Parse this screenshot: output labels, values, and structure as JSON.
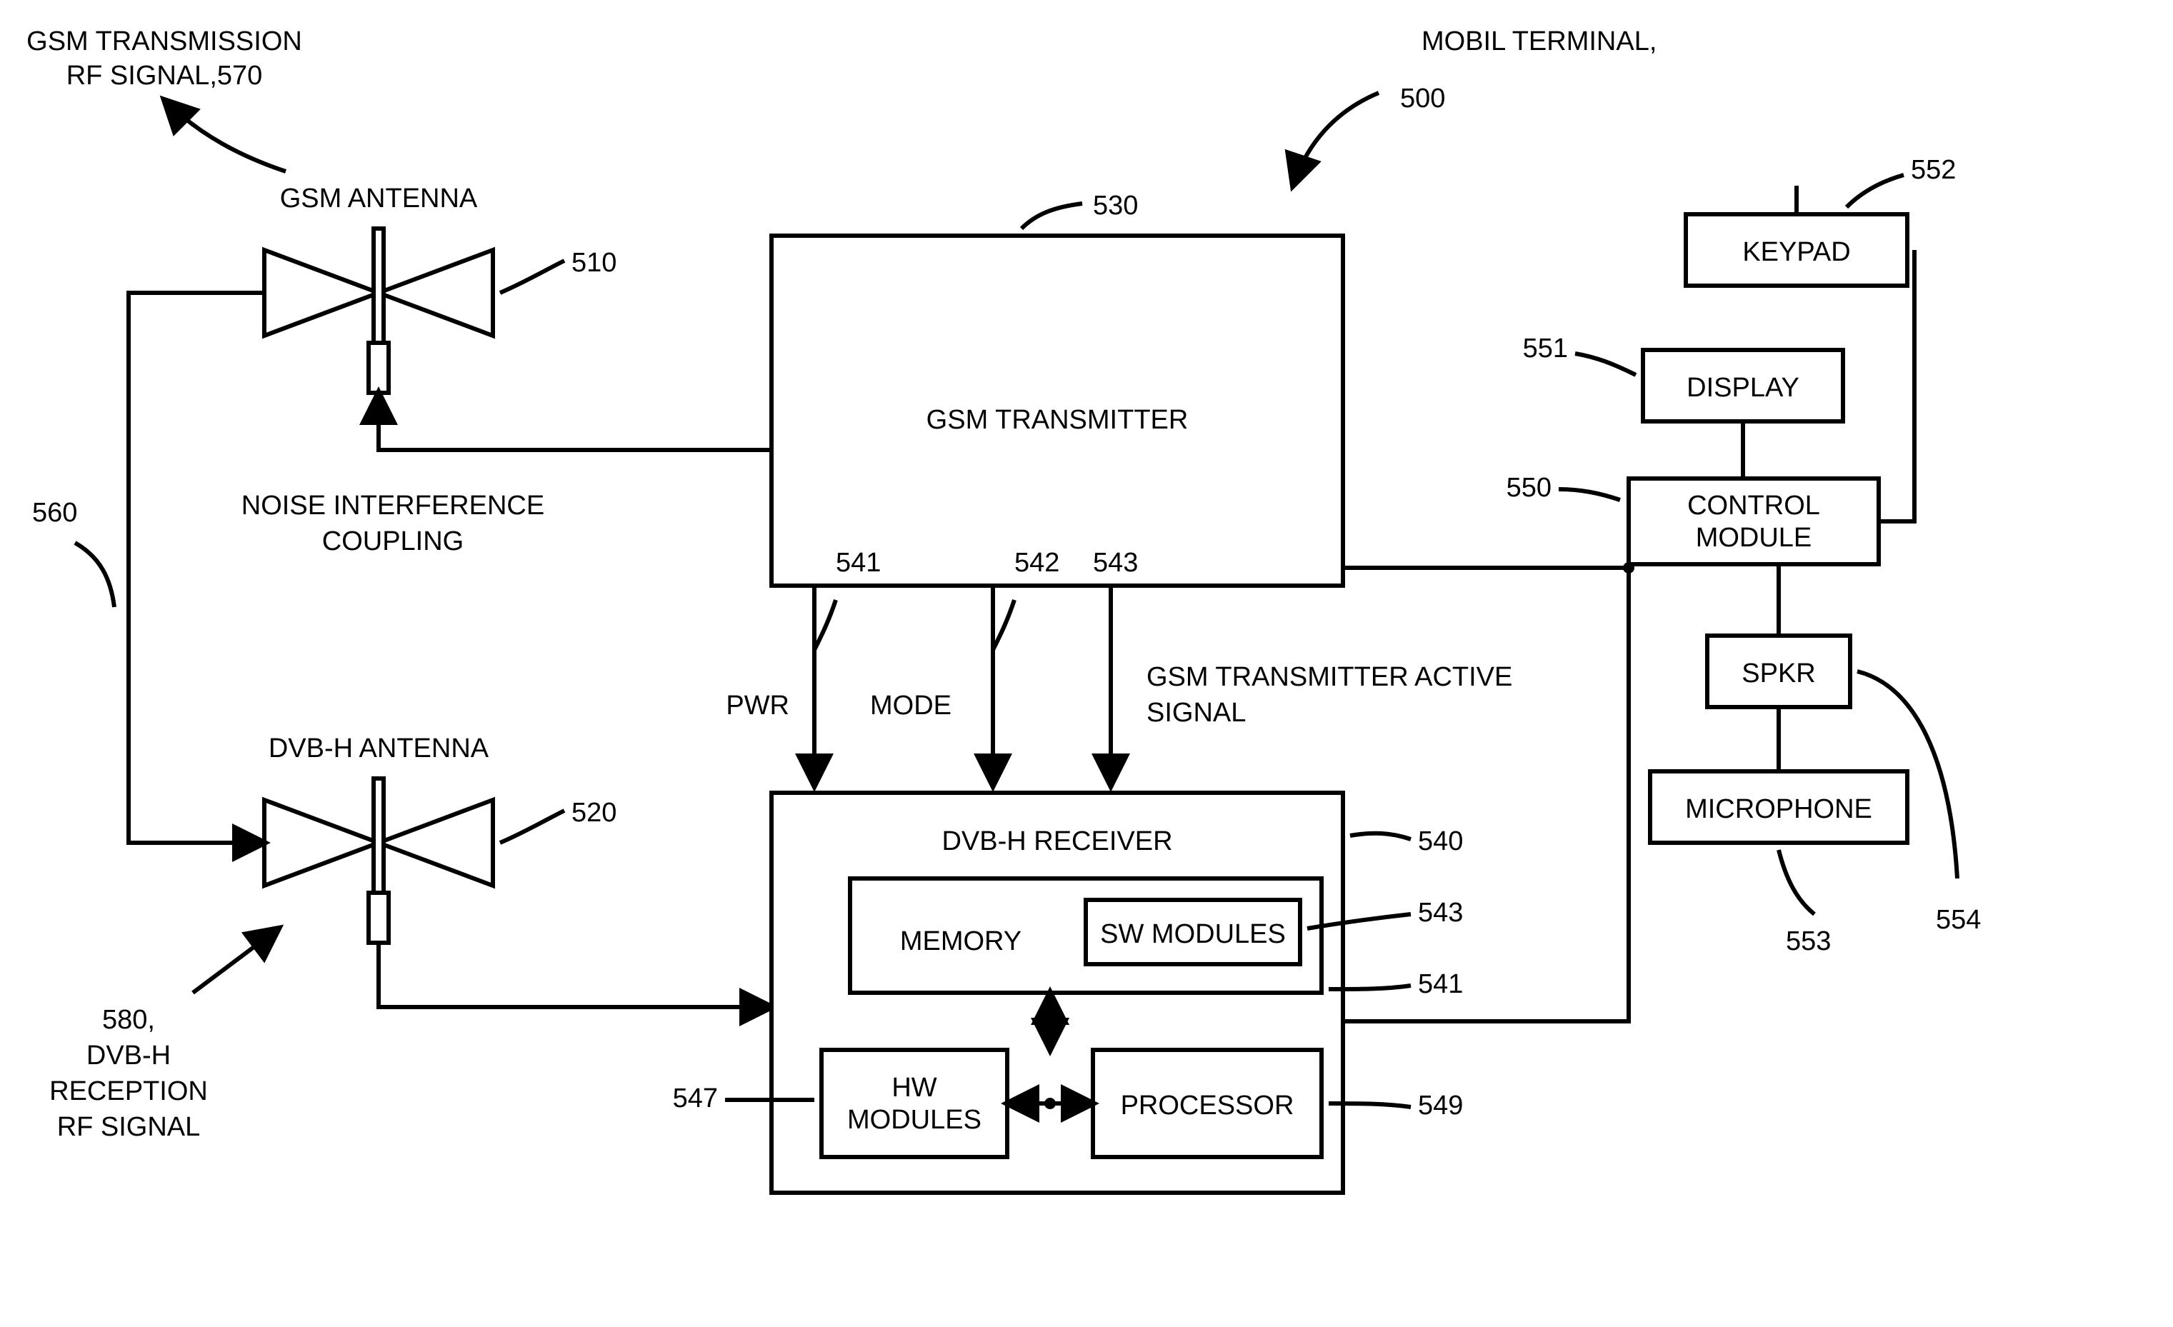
{
  "title": {
    "l1": "MOBIL TERMINAL,",
    "ref": "500"
  },
  "topLeft": {
    "l1": "GSM TRANSMISSION",
    "l2": "RF SIGNAL,570"
  },
  "bottomLeft": {
    "ref": "580,",
    "l1": "DVB-H",
    "l2": "RECEPTION",
    "l3": "RF SIGNAL"
  },
  "noise": {
    "l1": "NOISE INTERFERENCE",
    "l2": "COUPLING"
  },
  "noiseRef": "560",
  "gsmAnt": {
    "label": "GSM ANTENNA",
    "ref": "510"
  },
  "dvbAnt": {
    "label": "DVB-H ANTENNA",
    "ref": "520"
  },
  "gsmTx": {
    "label": "GSM TRANSMITTER",
    "ref": "530"
  },
  "sigRefs": {
    "pwr": "541",
    "mode": "542",
    "active": "543"
  },
  "sigLabels": {
    "pwr": "PWR",
    "mode": "MODE",
    "active": "GSM TRANSMITTER ACTIVE",
    "active2": "SIGNAL"
  },
  "rx": {
    "label": "DVB-H RECEIVER",
    "ref": "540"
  },
  "memory": {
    "label": "MEMORY",
    "ref": "541"
  },
  "sw": {
    "label": "SW MODULES",
    "ref": "543"
  },
  "hw": {
    "label": "HW",
    "label2": "MODULES",
    "ref": "547"
  },
  "proc": {
    "label": "PROCESSOR",
    "ref": "549"
  },
  "ctrl": {
    "label": "CONTROL",
    "label2": "MODULE",
    "ref": "550"
  },
  "disp": {
    "label": "DISPLAY",
    "ref": "551"
  },
  "key": {
    "label": "KEYPAD",
    "ref": "552"
  },
  "mic": {
    "label": "MICROPHONE",
    "ref": "553"
  },
  "spk": {
    "label": "SPKR",
    "ref": "554"
  }
}
